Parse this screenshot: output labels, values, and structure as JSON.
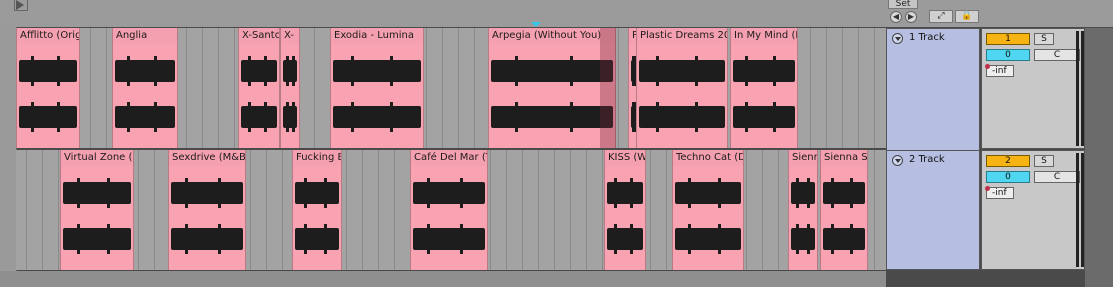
{
  "header": {
    "set_label": "Set",
    "nav_prev_symbol": "◀",
    "nav_next_symbol": "▶",
    "expand_symbol": "⤢",
    "lock_symbol": "🔒"
  },
  "tracks": [
    {
      "name": "1 Track",
      "number": "1",
      "solo_label": "S",
      "volume": "0",
      "pan": "C",
      "peak": "-inf",
      "clips": [
        "Afflitto (Origi",
        "Anglia",
        "X-Santo",
        "X-",
        "Exodia - Lumina",
        "Arpegia (Without You)",
        "P",
        "Plastic Dreams 20",
        "In My Mind (E"
      ]
    },
    {
      "name": "2 Track",
      "number": "2",
      "solo_label": "S",
      "volume": "0",
      "pan": "C",
      "peak": "-inf",
      "clips": [
        "Virtual Zone (C",
        "Sexdrive (M&B'",
        "Fucking B",
        "Café Del Mar (T",
        "KISS (W",
        "Techno Cat (D",
        "Sienn",
        "Sienna Sk"
      ]
    }
  ],
  "colors": {
    "clip": "#f9a3b2",
    "lane": "#a3a3a3",
    "track_header": "#b6bfe1",
    "arm": "#f5b314",
    "volume": "#4fd6f0",
    "locator": "#35c6e8"
  }
}
